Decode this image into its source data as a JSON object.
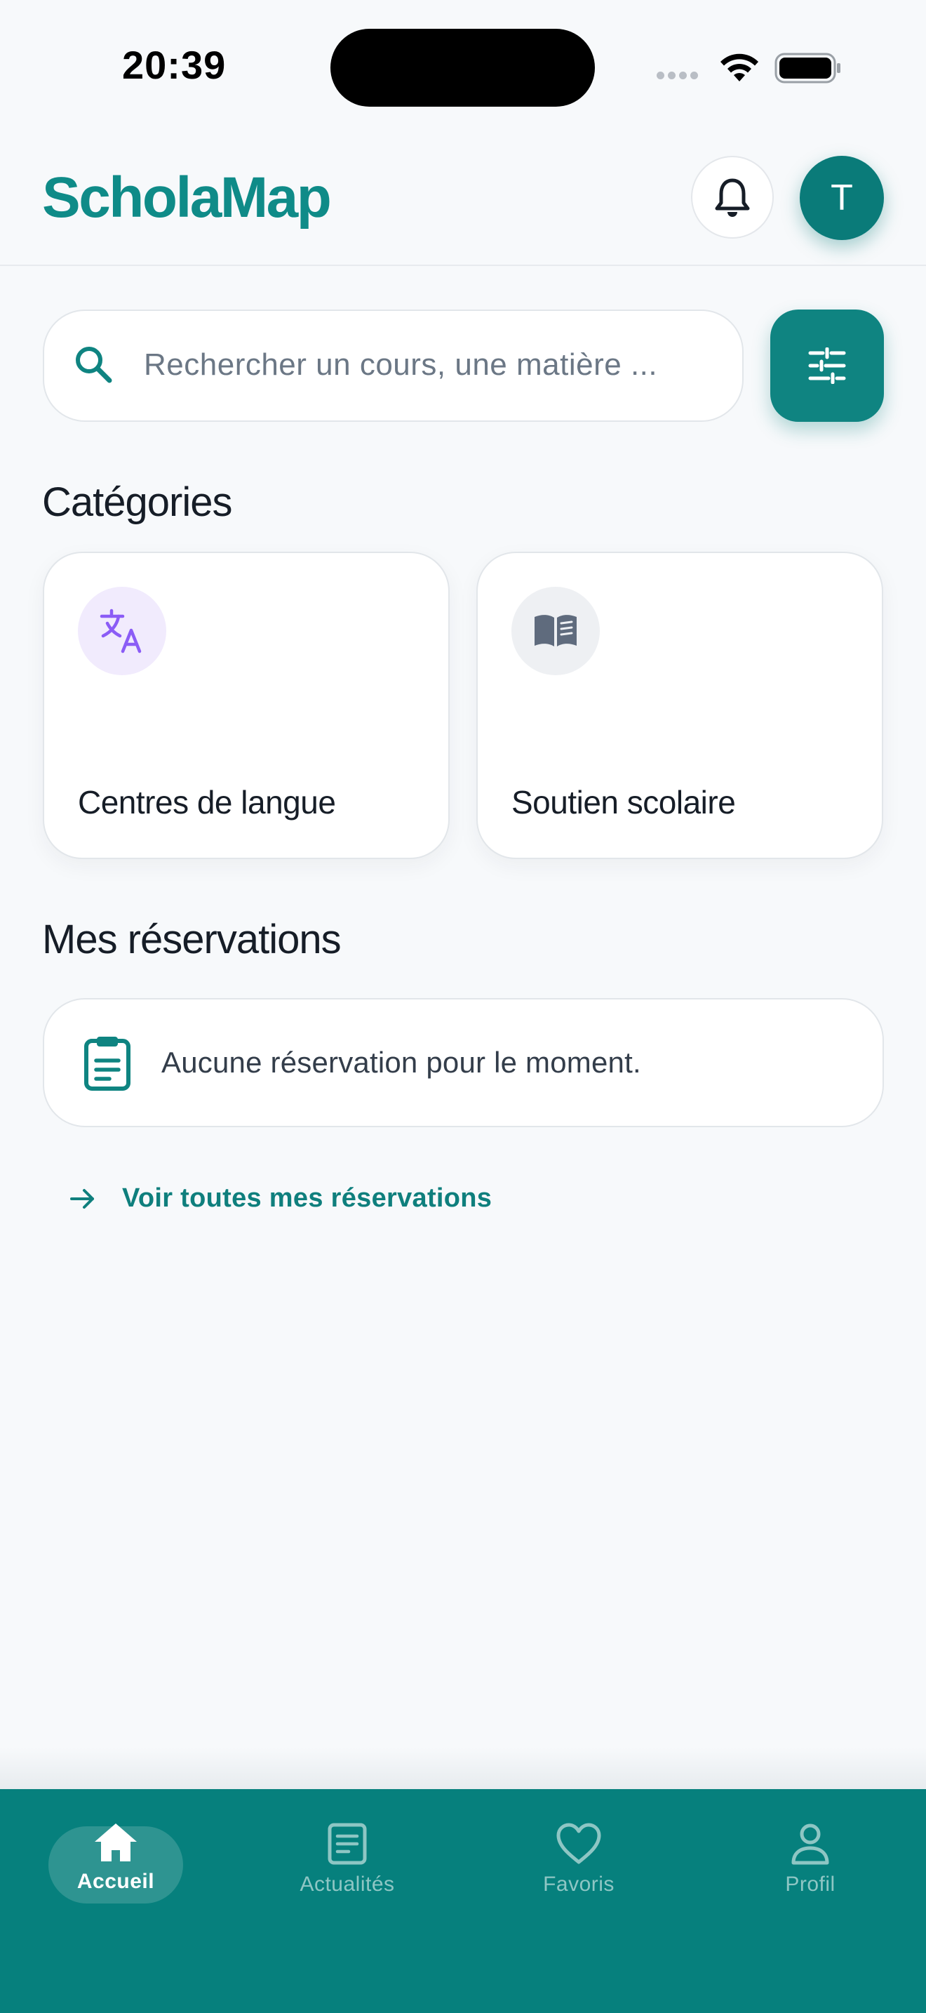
{
  "status_bar": {
    "time": "20:39"
  },
  "header": {
    "brand": "ScholaMap",
    "avatar_initial": "T"
  },
  "search": {
    "placeholder": "Rechercher un cours, une matière ..."
  },
  "categories": {
    "title": "Catégories",
    "items": [
      {
        "label": "Centres de langue",
        "icon": "translate-icon",
        "icon_bg": "#f1ebfd",
        "icon_color": "#8b5cf6"
      },
      {
        "label": "Soutien scolaire",
        "icon": "book-icon",
        "icon_bg": "#eef0f3",
        "icon_color": "#5f6b7d"
      }
    ]
  },
  "reservations": {
    "title": "Mes réservations",
    "empty_text": "Aucune réservation pour le moment.",
    "link_label": "Voir toutes mes réservations"
  },
  "bottom_nav": {
    "items": [
      {
        "label": "Accueil",
        "icon": "home-icon",
        "active": true
      },
      {
        "label": "Actualités",
        "icon": "news-icon",
        "active": false
      },
      {
        "label": "Favoris",
        "icon": "heart-icon",
        "active": false
      },
      {
        "label": "Profil",
        "icon": "user-icon",
        "active": false
      }
    ]
  },
  "colors": {
    "primary": "#0f8481",
    "brand_text": "#0f8b88",
    "background": "#f7f9fb"
  }
}
